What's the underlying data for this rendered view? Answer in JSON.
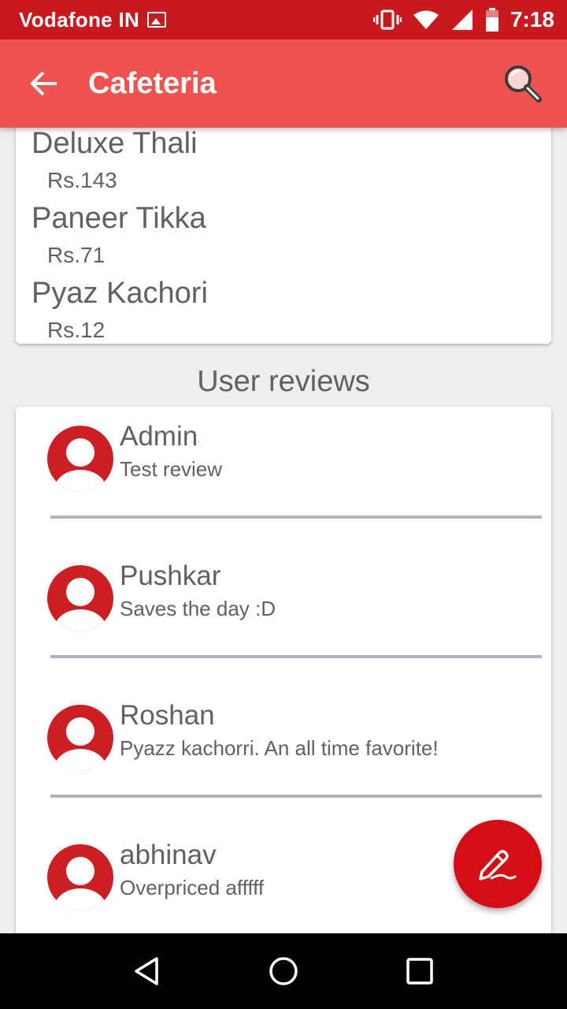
{
  "status_bar": {
    "carrier": "Vodafone IN",
    "time": "7:18"
  },
  "app_bar": {
    "title": "Cafeteria"
  },
  "menu": {
    "items": [
      {
        "name": "Deluxe Thali",
        "price": "Rs.143"
      },
      {
        "name": "Paneer Tikka",
        "price": "Rs.71"
      },
      {
        "name": "Pyaz Kachori",
        "price": "Rs.12"
      }
    ]
  },
  "reviews": {
    "title": "User reviews",
    "items": [
      {
        "user": "Admin",
        "text": "Test review"
      },
      {
        "user": "Pushkar",
        "text": "Saves the day :D"
      },
      {
        "user": "Roshan",
        "text": "Pyazz kachorri. An all time favorite!"
      },
      {
        "user": "abhinav",
        "text": "Overpriced afffff"
      }
    ]
  },
  "colors": {
    "status_bar": "#c8191f",
    "app_bar": "#ef5350",
    "accent": "#d40e14",
    "avatar": "#cc1f24"
  },
  "icons": {
    "back": "arrow-left-icon",
    "search": "magnifier-icon",
    "fab": "pen-write-icon"
  }
}
